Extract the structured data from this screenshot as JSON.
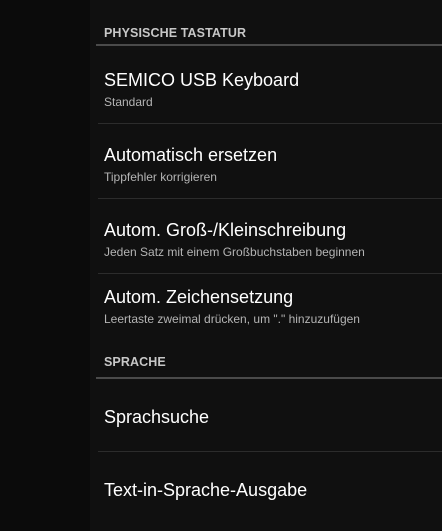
{
  "sections": [
    {
      "header": "PHYSISCHE TASTATUR",
      "items": [
        {
          "title": "SEMICO USB Keyboard",
          "summary": "Standard"
        },
        {
          "title": "Automatisch ersetzen",
          "summary": "Tippfehler korrigieren"
        },
        {
          "title": "Autom. Groß-/Kleinschreibung",
          "summary": "Jeden Satz mit einem Großbuchstaben beginnen"
        },
        {
          "title": "Autom. Zeichensetzung",
          "summary": "Leertaste zweimal drücken, um \".\" hinzuzufügen"
        }
      ]
    },
    {
      "header": "SPRACHE",
      "items": [
        {
          "title": "Sprachsuche"
        },
        {
          "title": "Text-in-Sprache-Ausgabe"
        }
      ]
    }
  ]
}
